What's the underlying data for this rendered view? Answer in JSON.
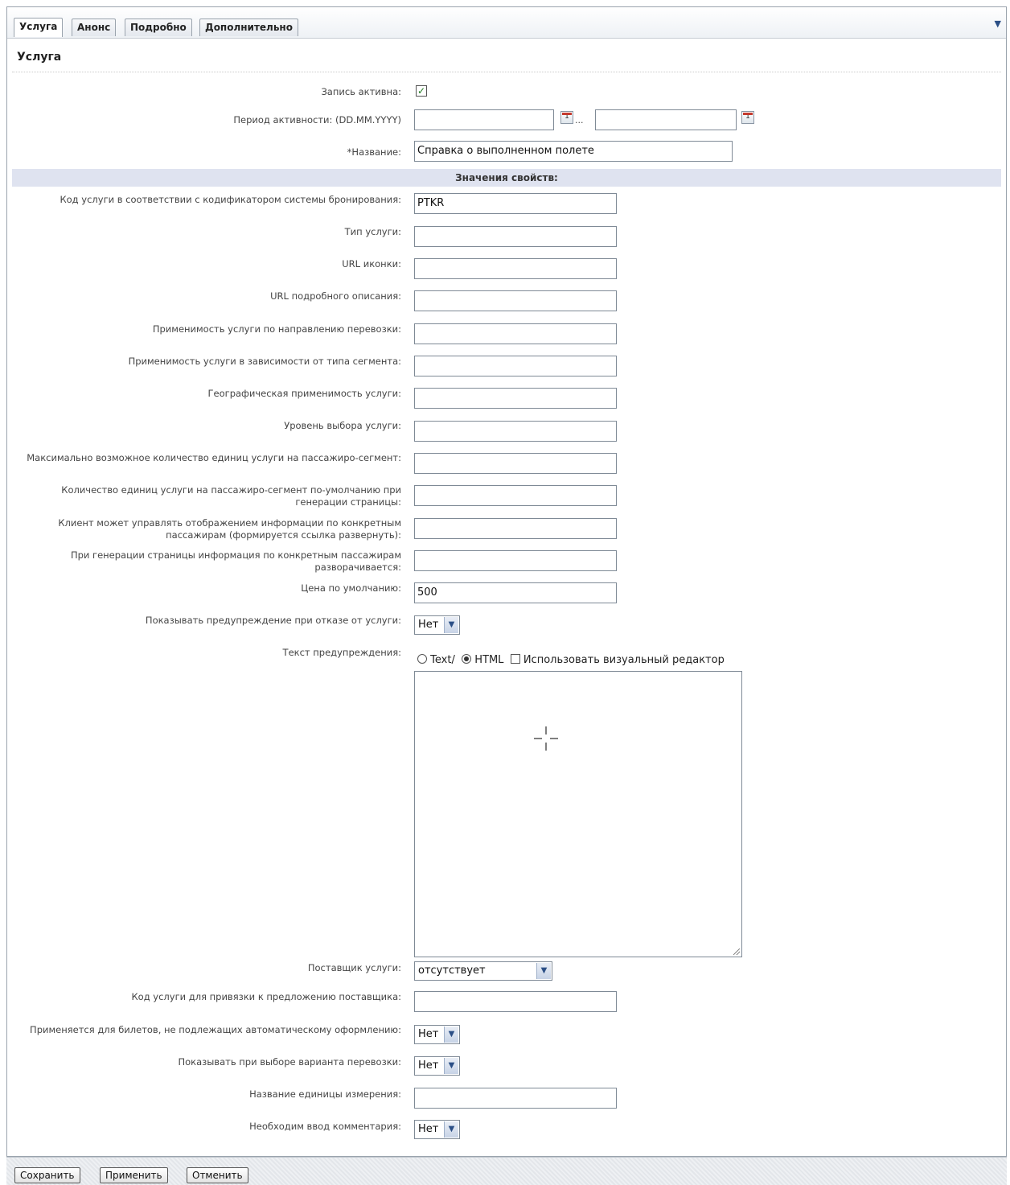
{
  "tabs": [
    {
      "label": "Услуга",
      "active": true
    },
    {
      "label": "Анонс",
      "active": false
    },
    {
      "label": "Подробно",
      "active": false
    },
    {
      "label": "Дополнительно",
      "active": false
    }
  ],
  "section_title": "Услуга",
  "form": {
    "active_label": "Запись активна:",
    "active_checked": true,
    "period_label": "Период активности: (DD.MM.YYYY)",
    "period_separator": "...",
    "name_label": "*Название:",
    "name_value": "Справка о выполненном полете",
    "props_header": "Значения свойств:",
    "code_label": "Код услуги в соответствии с кодификатором системы бронирования:",
    "code_value": "PTKR",
    "type_label": "Тип услуги:",
    "icon_url_label": "URL иконки:",
    "desc_url_label": "URL подробного описания:",
    "direction_label": "Применимость услуги по направлению перевозки:",
    "segment_type_label": "Применимость услуги в зависимости от типа сегмента:",
    "geo_label": "Географическая применимость услуги:",
    "level_label": "Уровень выбора услуги:",
    "max_units_label": "Максимально возможное количество единиц услуги на пассажиро-сегмент:",
    "default_units_label": "Количество единиц услуги на пассажиро-сегмент по-умолчанию при генерации страницы:",
    "client_display_label": "Клиент может управлять отображением информации по конкретным пассажирам (формируется ссылка развернуть):",
    "expand_label": "При генерации страницы информация по конкретным пассажирам разворачивается:",
    "price_label": "Цена по умолчанию:",
    "price_value": "500",
    "warn_show_label": "Показывать предупреждение при отказе от услуги:",
    "warn_show_value": "Нет",
    "warn_text_label": "Текст предупреждения:",
    "radio_text": "Text",
    "radio_text_suffix": "/",
    "radio_html": "HTML",
    "visual_editor_label": "Использовать визуальный редактор",
    "supplier_label": "Поставщик услуги:",
    "supplier_value": "отсутствует",
    "supplier_code_label": "Код услуги для привязки к предложению поставщика:",
    "non_auto_label": "Применяется для билетов, не подлежащих автоматическому оформлению:",
    "non_auto_value": "Нет",
    "show_on_select_label": "Показывать при выборе варианта перевозки:",
    "show_on_select_value": "Нет",
    "unit_name_label": "Название единицы измерения:",
    "comment_required_label": "Необходим ввод комментария:",
    "comment_required_value": "Нет"
  },
  "buttons": {
    "save": "Сохранить",
    "apply": "Применить",
    "cancel": "Отменить"
  },
  "icons": {
    "tab_menu": "chevron-down-icon",
    "calendar": "calendar-icon",
    "select_arrow": "chevron-down-icon"
  }
}
